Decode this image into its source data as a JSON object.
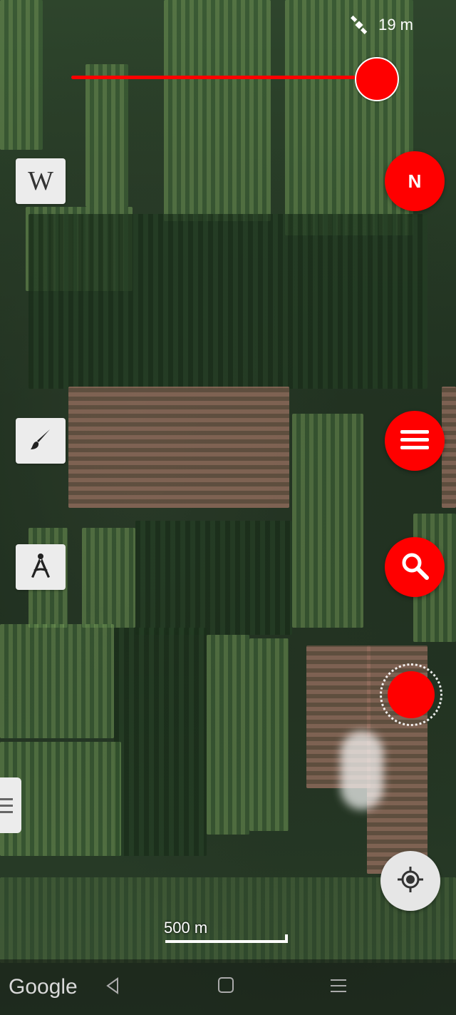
{
  "status": {
    "gps_accuracy": "19 m",
    "satellite_icon": "satellite-icon"
  },
  "buttons": {
    "north_label": "N"
  },
  "scale": {
    "label": "500 m"
  },
  "attribution": {
    "provider": "Google"
  },
  "colors": {
    "accent": "#ff0000",
    "tool_bg": "#ececec"
  },
  "tools": {
    "wiki_label": "W"
  }
}
